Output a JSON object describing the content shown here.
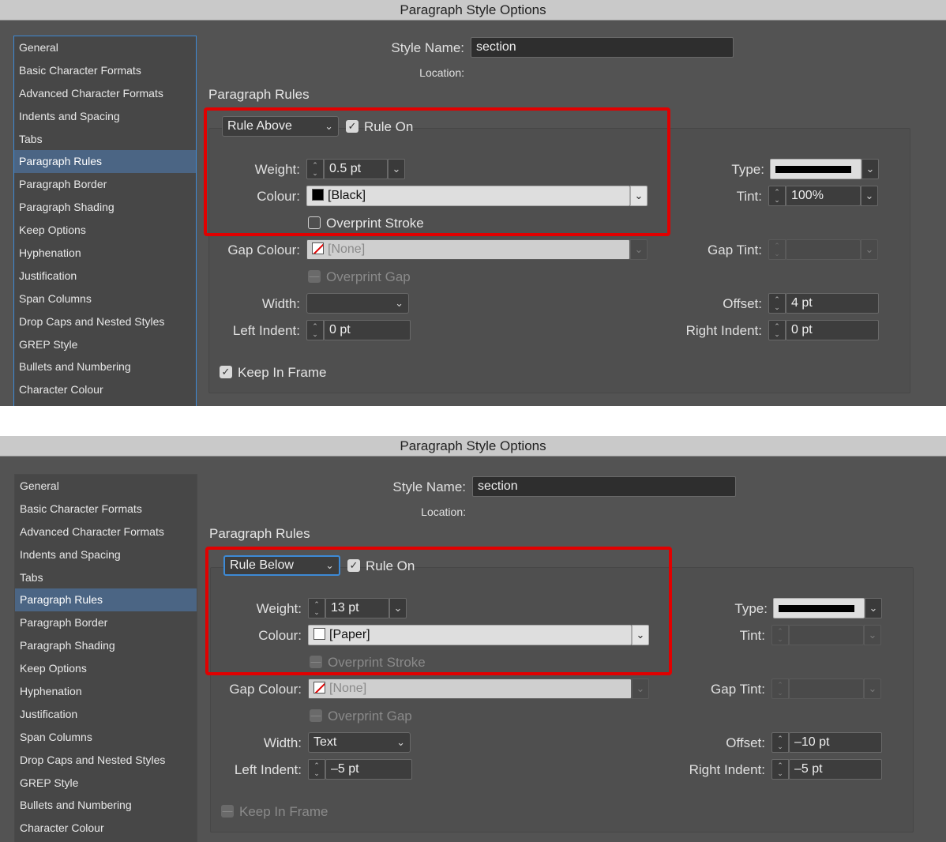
{
  "panels": [
    {
      "title": "Paragraph Style Options",
      "sidebar": [
        "General",
        "Basic Character Formats",
        "Advanced Character Formats",
        "Indents and Spacing",
        "Tabs",
        "Paragraph Rules",
        "Paragraph Border",
        "Paragraph Shading",
        "Keep Options",
        "Hyphenation",
        "Justification",
        "Span Columns",
        "Drop Caps and Nested Styles",
        "GREP Style",
        "Bullets and Numbering",
        "Character Colour"
      ],
      "selected_item": "Paragraph Rules",
      "style_name_label": "Style Name:",
      "style_name": "section",
      "location_label": "Location:",
      "section_heading": "Paragraph Rules",
      "rule_select": "Rule Above",
      "rule_on_label": "Rule On",
      "rule_on": true,
      "weight_label": "Weight:",
      "weight": "0.5 pt",
      "type_label": "Type:",
      "colour_label": "Colour:",
      "colour": "[Black]",
      "tint_label": "Tint:",
      "tint": "100%",
      "overprint_stroke_label": "Overprint Stroke",
      "gap_colour_label": "Gap Colour:",
      "gap_colour": "[None]",
      "gap_tint_label": "Gap Tint:",
      "overprint_gap_label": "Overprint Gap",
      "width_label": "Width:",
      "width": "",
      "offset_label": "Offset:",
      "offset": "4 pt",
      "left_indent_label": "Left Indent:",
      "left_indent": "0 pt",
      "right_indent_label": "Right Indent:",
      "right_indent": "0 pt",
      "keep_in_frame_label": "Keep In Frame",
      "keep_in_frame": true
    },
    {
      "title": "Paragraph Style Options",
      "sidebar": [
        "General",
        "Basic Character Formats",
        "Advanced Character Formats",
        "Indents and Spacing",
        "Tabs",
        "Paragraph Rules",
        "Paragraph Border",
        "Paragraph Shading",
        "Keep Options",
        "Hyphenation",
        "Justification",
        "Span Columns",
        "Drop Caps and Nested Styles",
        "GREP Style",
        "Bullets and Numbering",
        "Character Colour"
      ],
      "selected_item": "Paragraph Rules",
      "style_name_label": "Style Name:",
      "style_name": "section",
      "location_label": "Location:",
      "section_heading": "Paragraph Rules",
      "rule_select": "Rule Below",
      "rule_on_label": "Rule On",
      "rule_on": true,
      "weight_label": "Weight:",
      "weight": "13 pt",
      "type_label": "Type:",
      "colour_label": "Colour:",
      "colour": "[Paper]",
      "tint_label": "Tint:",
      "tint": "",
      "overprint_stroke_label": "Overprint Stroke",
      "gap_colour_label": "Gap Colour:",
      "gap_colour": "[None]",
      "gap_tint_label": "Gap Tint:",
      "overprint_gap_label": "Overprint Gap",
      "width_label": "Width:",
      "width": "Text",
      "offset_label": "Offset:",
      "offset": "–10 pt",
      "left_indent_label": "Left Indent:",
      "left_indent": "–5 pt",
      "right_indent_label": "Right Indent:",
      "right_indent": "–5 pt",
      "keep_in_frame_label": "Keep In Frame",
      "keep_in_frame": false
    }
  ],
  "colors": {
    "highlight": "#e10000",
    "selection": "#4b6584",
    "focus": "#3d8ad6",
    "dialog_bg": "#535353"
  }
}
